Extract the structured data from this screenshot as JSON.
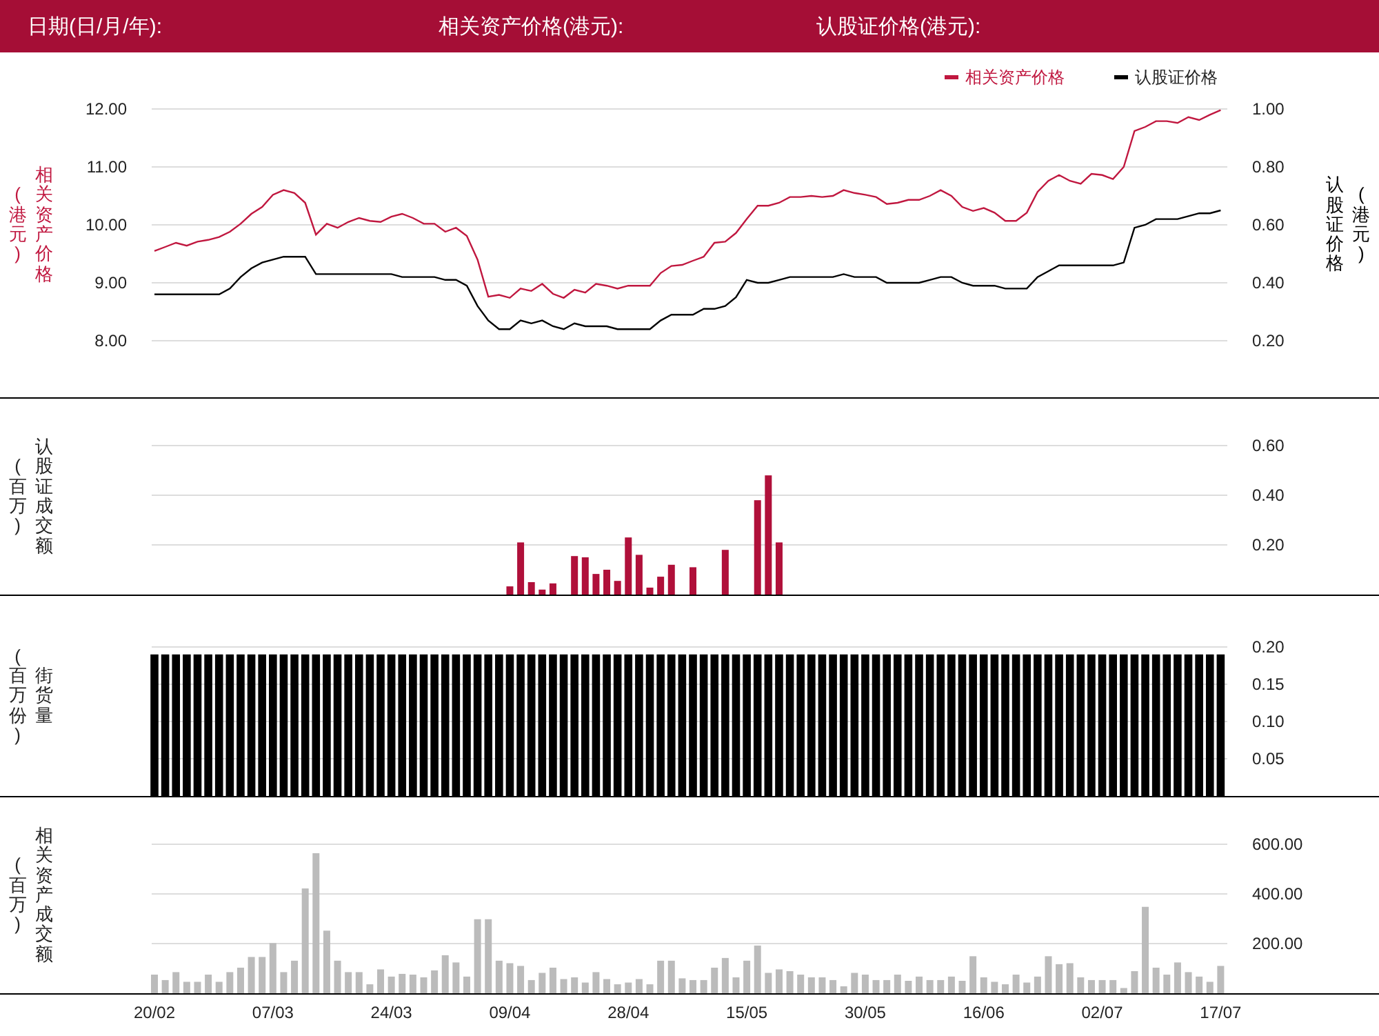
{
  "header": [
    {
      "label": "日期(日/月/年):"
    },
    {
      "label": "相关资产价格(港元):"
    },
    {
      "label": "认股证价格(港元):"
    }
  ],
  "price_panel": {
    "left_unit": "(港元)",
    "left_title": "相关资产价格",
    "right_title": "认股证价格",
    "right_unit": "(港元)",
    "chart_data": {
      "type": "line",
      "grid": true,
      "legend": "top-right",
      "y2lim": [
        0.2,
        1.0
      ],
      "y2ticks": [
        {
          "value": 1.0,
          "label": "1.00"
        },
        {
          "value": 0.8,
          "label": "0.80"
        },
        {
          "value": 0.6,
          "label": "0.60"
        },
        {
          "value": 0.4,
          "label": "0.40"
        },
        {
          "value": 0.2,
          "label": "0.20"
        }
      ],
      "ylim": [
        8,
        12
      ],
      "yticks": [
        {
          "value": 12,
          "label": "12.00"
        },
        {
          "value": 11,
          "label": "11.00"
        },
        {
          "value": 10,
          "label": "10.00"
        },
        {
          "value": 9,
          "label": "9.00"
        },
        {
          "value": 8,
          "label": "8.00"
        }
      ],
      "series": [
        {
          "name": "相关资产价格",
          "color": "#c0173f",
          "values": [
            9.55,
            9.62,
            9.69,
            9.64,
            9.71,
            9.74,
            9.79,
            9.88,
            10.02,
            10.19,
            10.31,
            10.52,
            10.6,
            10.55,
            10.38,
            9.83,
            10.02,
            9.95,
            10.05,
            10.12,
            10.07,
            10.05,
            10.14,
            10.19,
            10.12,
            10.02,
            10.02,
            9.88,
            9.95,
            9.81,
            9.4,
            8.76,
            8.79,
            8.74,
            8.9,
            8.86,
            8.98,
            8.81,
            8.74,
            8.88,
            8.83,
            8.98,
            8.95,
            8.9,
            8.95,
            8.95,
            8.95,
            9.17,
            9.29,
            9.31,
            9.38,
            9.45,
            9.69,
            9.71,
            9.86,
            10.1,
            10.33,
            10.33,
            10.38,
            10.48,
            10.48,
            10.5,
            10.48,
            10.5,
            10.6,
            10.55,
            10.52,
            10.48,
            10.36,
            10.38,
            10.43,
            10.43,
            10.5,
            10.6,
            10.5,
            10.31,
            10.24,
            10.29,
            10.21,
            10.07,
            10.07,
            10.21,
            10.57,
            10.76,
            10.86,
            10.76,
            10.71,
            10.88,
            10.86,
            10.79,
            11.0,
            11.62,
            11.69,
            11.79,
            11.79,
            11.76,
            11.86,
            11.81,
            11.9,
            11.98
          ]
        },
        {
          "name": "认股证价格",
          "color": "#000000",
          "axis": "y2",
          "values": [
            0.36,
            0.36,
            0.36,
            0.36,
            0.36,
            0.36,
            0.36,
            0.38,
            0.42,
            0.45,
            0.47,
            0.48,
            0.49,
            0.49,
            0.49,
            0.43,
            0.43,
            0.43,
            0.43,
            0.43,
            0.43,
            0.43,
            0.43,
            0.42,
            0.42,
            0.42,
            0.42,
            0.41,
            0.41,
            0.39,
            0.32,
            0.27,
            0.24,
            0.24,
            0.27,
            0.26,
            0.27,
            0.25,
            0.24,
            0.26,
            0.25,
            0.25,
            0.25,
            0.24,
            0.24,
            0.24,
            0.24,
            0.27,
            0.29,
            0.29,
            0.29,
            0.31,
            0.31,
            0.32,
            0.35,
            0.41,
            0.4,
            0.4,
            0.41,
            0.42,
            0.42,
            0.42,
            0.42,
            0.42,
            0.43,
            0.42,
            0.42,
            0.42,
            0.4,
            0.4,
            0.4,
            0.4,
            0.41,
            0.42,
            0.42,
            0.4,
            0.39,
            0.39,
            0.39,
            0.38,
            0.38,
            0.38,
            0.42,
            0.44,
            0.46,
            0.46,
            0.46,
            0.46,
            0.46,
            0.46,
            0.47,
            0.59,
            0.6,
            0.62,
            0.62,
            0.62,
            0.63,
            0.64,
            0.64,
            0.65
          ]
        }
      ]
    }
  },
  "bar_panels": [
    {
      "left_unit": "(百万)",
      "chart_data": {
        "type": "bar",
        "grid": true,
        "ylim": [
          0,
          0.6
        ],
        "yticks": [
          {
            "value": 0.6,
            "label": "0.60"
          },
          {
            "value": 0.4,
            "label": "0.40"
          },
          {
            "value": 0.2,
            "label": "0.20"
          }
        ],
        "series": [
          {
            "name": "认股证成交额",
            "color": "#b0103a",
            "values": [
              0,
              0,
              0,
              0,
              0,
              0,
              0,
              0,
              0,
              0,
              0,
              0,
              0,
              0,
              0,
              0,
              0,
              0,
              0,
              0,
              0,
              0,
              0,
              0,
              0,
              0,
              0,
              0,
              0,
              0,
              0,
              0,
              0,
              0.033,
              0.21,
              0.05,
              0.02,
              0.045,
              0,
              0.155,
              0.15,
              0.083,
              0.1,
              0.055,
              0.23,
              0.16,
              0.028,
              0.072,
              0.12,
              0,
              0.11,
              0,
              0,
              0.18,
              0,
              0,
              0.38,
              0.48,
              0.21,
              0,
              0,
              0,
              0,
              0,
              0,
              0,
              0,
              0,
              0,
              0,
              0,
              0,
              0,
              0,
              0,
              0,
              0,
              0,
              0,
              0,
              0,
              0,
              0,
              0,
              0,
              0,
              0,
              0,
              0,
              0,
              0,
              0,
              0,
              0,
              0,
              0,
              0,
              0,
              0,
              0
            ]
          }
        ]
      }
    },
    {
      "left_unit": "(百万份)",
      "chart_data": {
        "type": "bar",
        "grid": true,
        "ylim": [
          0,
          0.2
        ],
        "yticks": [
          {
            "value": 0.2,
            "label": "0.20"
          },
          {
            "value": 0.15,
            "label": "0.15"
          },
          {
            "value": 0.1,
            "label": "0.10"
          },
          {
            "value": 0.05,
            "label": "0.05"
          }
        ],
        "series": [
          {
            "name": "街货量",
            "color": "#000000",
            "values": [
              0.19,
              0.19,
              0.19,
              0.19,
              0.19,
              0.19,
              0.19,
              0.19,
              0.19,
              0.19,
              0.19,
              0.19,
              0.19,
              0.19,
              0.19,
              0.19,
              0.19,
              0.19,
              0.19,
              0.19,
              0.19,
              0.19,
              0.19,
              0.19,
              0.19,
              0.19,
              0.19,
              0.19,
              0.19,
              0.19,
              0.19,
              0.19,
              0.19,
              0.19,
              0.19,
              0.19,
              0.19,
              0.19,
              0.19,
              0.19,
              0.19,
              0.19,
              0.19,
              0.19,
              0.19,
              0.19,
              0.19,
              0.19,
              0.19,
              0.19,
              0.19,
              0.19,
              0.19,
              0.19,
              0.19,
              0.19,
              0.19,
              0.19,
              0.19,
              0.19,
              0.19,
              0.19,
              0.19,
              0.19,
              0.19,
              0.19,
              0.19,
              0.19,
              0.19,
              0.19,
              0.19,
              0.19,
              0.19,
              0.19,
              0.19,
              0.19,
              0.19,
              0.19,
              0.19,
              0.19,
              0.19,
              0.19,
              0.19,
              0.19,
              0.19,
              0.19,
              0.19,
              0.19,
              0.19,
              0.19,
              0.19,
              0.19,
              0.19,
              0.19,
              0.19,
              0.19,
              0.19,
              0.19,
              0.19,
              0.19
            ]
          }
        ]
      }
    },
    {
      "left_unit": "(百万)",
      "chart_data": {
        "type": "bar",
        "grid": true,
        "ylim": [
          0,
          600
        ],
        "yticks": [
          {
            "value": 600,
            "label": "600.00"
          },
          {
            "value": 400,
            "label": "400.00"
          },
          {
            "value": 200,
            "label": "200.00"
          }
        ],
        "series": [
          {
            "name": "相关资产成交额",
            "color": "#bbbbbb",
            "values": [
              75,
              53,
              85,
              46,
              46,
              75,
              46,
              85,
              103,
              146,
              146,
              202,
              85,
              131,
              422,
              564,
              252,
              131,
              85,
              85,
              36,
              96,
              67,
              78,
              75,
              64,
              92,
              153,
              124,
              67,
              298,
              298,
              131,
              121,
              110,
              53,
              82,
              103,
              57,
              64,
              43,
              85,
              57,
              36,
              43,
              57,
              36,
              131,
              131,
              60,
              53,
              53,
              103,
              142,
              64,
              131,
              192,
              82,
              96,
              89,
              75,
              64,
              64,
              53,
              28,
              82,
              75,
              53,
              53,
              75,
              50,
              67,
              53,
              53,
              67,
              50,
              149,
              64,
              46,
              36,
              75,
              43,
              67,
              149,
              117,
              121,
              64,
              53,
              53,
              53,
              21,
              89,
              348,
              103,
              75,
              124,
              85,
              67,
              46,
              110
            ]
          }
        ]
      }
    }
  ],
  "date_axis": {
    "labels": [
      "20/02",
      "07/03",
      "24/03",
      "09/04",
      "28/04",
      "15/05",
      "30/05",
      "16/06",
      "02/07",
      "17/07"
    ]
  }
}
